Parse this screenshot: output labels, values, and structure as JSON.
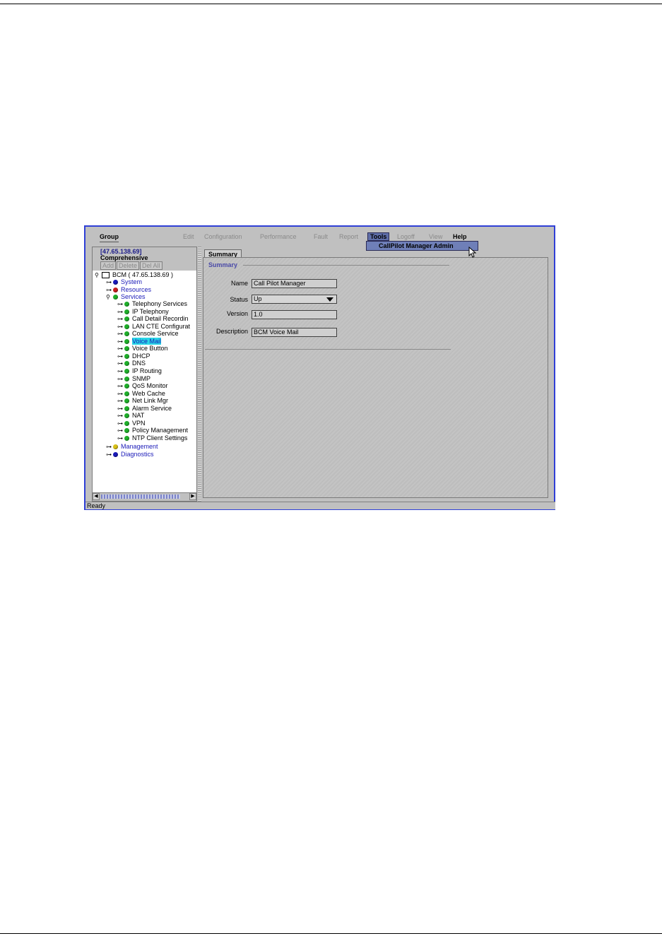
{
  "menubar": {
    "group": "Group",
    "items": [
      {
        "label": "Edit",
        "enabled": false
      },
      {
        "label": "Configuration",
        "enabled": false
      },
      {
        "label": "Performance",
        "enabled": false
      },
      {
        "label": "Fault",
        "enabled": false
      },
      {
        "label": "Report",
        "enabled": false
      },
      {
        "label": "Tools",
        "enabled": true,
        "active": true
      },
      {
        "label": "Logoff",
        "enabled": false
      },
      {
        "label": "View",
        "enabled": false
      },
      {
        "label": "Help",
        "enabled": true
      }
    ],
    "dropdown_item": "CallPilot Manager Admin"
  },
  "left_panel": {
    "ip": "[47.65.138.69]",
    "scope": "Comprehensive",
    "buttons": [
      "Add",
      "Delete",
      "Del All"
    ]
  },
  "tree": {
    "root": "BCM ( 47.65.138.69 )",
    "top_level": [
      {
        "label": "System",
        "dot_color": "#1a1ab8"
      },
      {
        "label": "Resources",
        "dot_color": "#c81e1e"
      },
      {
        "label": "Services",
        "dot_color": "#1fae2a"
      }
    ],
    "services": [
      "Telephony Services",
      "IP Telephony",
      "Call Detail Recordin",
      "LAN CTE Configurat",
      "Console Service",
      "Voice Mail",
      "Voice Button",
      "DHCP",
      "DNS",
      "IP Routing",
      "SNMP",
      "QoS Monitor",
      "Web Cache",
      "Net Link Mgr",
      "Alarm Service",
      "NAT",
      "VPN",
      "Policy Management",
      "NTP Client Settings"
    ],
    "selected": "Voice Mail",
    "bottom_level": [
      {
        "label": "Management",
        "dot_color": "#d8c018"
      },
      {
        "label": "Diagnostics",
        "dot_color": "#1a1ab8"
      }
    ]
  },
  "details": {
    "tab": "Summary",
    "section": "Summary",
    "name_label": "Name",
    "name_value": "Call Pilot Manager",
    "status_label": "Status",
    "status_value": "Up",
    "version_label": "Version",
    "version_value": "1.0",
    "description_label": "Description",
    "description_value": "BCM Voice Mail"
  },
  "status_bar": "Ready",
  "colors": {
    "window_border": "#2f3fd6",
    "selection": "#29d6e6",
    "service_dot": "#1fae2a"
  }
}
